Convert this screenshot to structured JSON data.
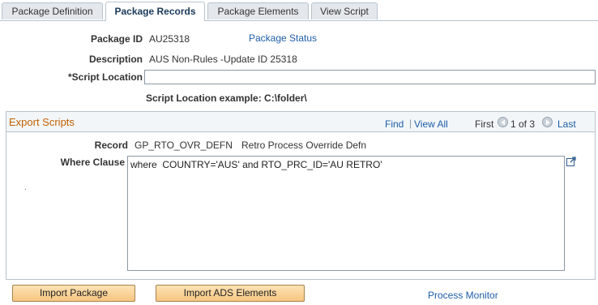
{
  "tabs": [
    {
      "label": "Package Definition",
      "active": false
    },
    {
      "label": "Package Records",
      "active": true
    },
    {
      "label": "Package Elements",
      "active": false
    },
    {
      "label": "View Script",
      "active": false
    }
  ],
  "header": {
    "package_id_label": "Package ID",
    "package_id_value": "AU25318",
    "package_status_link": "Package Status",
    "description_label": "Description",
    "description_value": "AUS Non-Rules -Update ID 25318",
    "script_location_label": "*Script Location",
    "script_location_value": "",
    "script_location_example": "Script Location example: C:\\folder\\"
  },
  "export_scripts": {
    "title": "Export Scripts",
    "find_link": "Find",
    "separator": "|",
    "view_all_link": "View All",
    "first_label": "First",
    "pagination_text": "1 of 3",
    "last_label": "Last",
    "record_label": "Record",
    "record_value": "GP_RTO_OVR_DEFN",
    "record_description": "Retro Process Override Defn",
    "where_clause_label": "Where Clause",
    "where_clause_value": "where  COUNTRY='AUS' and RTO_PRC_ID='AU RETRO'",
    "stray_mark": "."
  },
  "footer": {
    "import_package_button": "Import Package",
    "import_ads_button": "Import ADS Elements",
    "process_monitor_link": "Process Monitor"
  },
  "colors": {
    "link": "#1e5ea8",
    "group_title": "#c26000",
    "button_bg": "#f6c681"
  },
  "icons": {
    "prev": "arrow-left-circle-icon",
    "next": "arrow-right-circle-icon",
    "expand": "expand-window-icon"
  }
}
